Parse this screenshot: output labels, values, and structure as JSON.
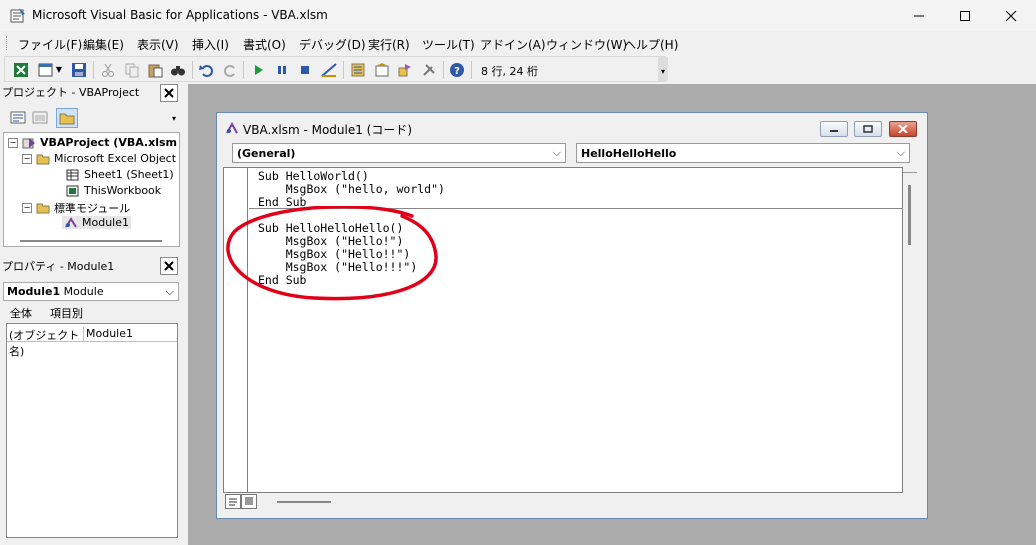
{
  "window": {
    "title": "Microsoft Visual Basic for Applications - VBA.xlsm",
    "minimize_icon": "minimize-icon",
    "maximize_icon": "maximize-icon",
    "close_icon": "close-icon"
  },
  "menu": {
    "items": [
      "ファイル(F)",
      "編集(E)",
      "表示(V)",
      "挿入(I)",
      "書式(O)",
      "デバッグ(D)",
      "実行(R)",
      "ツール(T)",
      "アドイン(A)",
      "ウィンドウ(W)",
      "ヘルプ(H)"
    ]
  },
  "toolbar": {
    "cursor_position": "8 行, 24 桁"
  },
  "project_pane": {
    "title": "プロジェクト - VBAProject",
    "tree": {
      "root": "VBAProject (VBA.xlsm",
      "excel_objects": "Microsoft Excel Object",
      "sheet1": "Sheet1 (Sheet1)",
      "workbook": "ThisWorkbook",
      "modules_folder": "標準モジュール",
      "module1": "Module1"
    }
  },
  "properties_pane": {
    "title": "プロパティ - Module1",
    "object_name": "Module1",
    "object_type": "Module",
    "tab_all": "全体",
    "tab_category": "項目別",
    "rows": [
      {
        "key": "(オブジェクト名)",
        "value": "Module1"
      }
    ]
  },
  "code_window": {
    "title": "VBA.xlsm - Module1 (コード)",
    "object_combo": "(General)",
    "procedure_combo": "HelloHelloHello",
    "code_lines": [
      "Sub HelloWorld()",
      "    MsgBox (\"hello, world\")",
      "End Sub",
      "Sub HelloHelloHello()",
      "    MsgBox (\"Hello!\")",
      "    MsgBox (\"Hello!!\")",
      "    MsgBox (\"Hello!!!\")",
      "End Sub"
    ],
    "annotation_color": "#e0001a"
  }
}
